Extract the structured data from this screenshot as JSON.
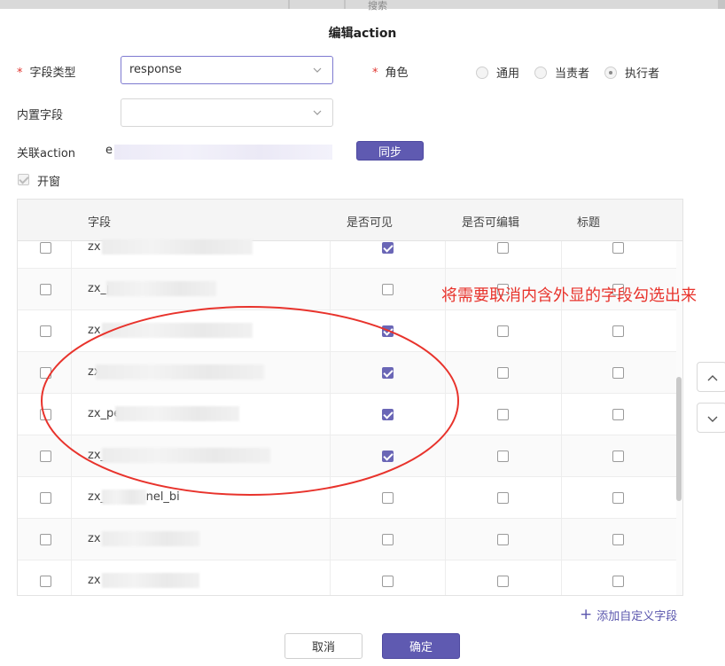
{
  "topbar": {
    "ghost_text": "搜索"
  },
  "dialog": {
    "title": "编辑action"
  },
  "form": {
    "field_type": {
      "label": "字段类型",
      "value": "response"
    },
    "role": {
      "label": "角色",
      "options": [
        "通用",
        "当责者",
        "执行者"
      ],
      "selected": "执行者"
    },
    "builtin_field": {
      "label": "内置字段",
      "value": ""
    },
    "linked_action": {
      "label": "关联action",
      "value_prefix": "e",
      "sync_label": "同步"
    },
    "open_window": {
      "label": "开窗",
      "checked": true
    }
  },
  "table": {
    "columns": [
      "字段",
      "是否可见",
      "是否可编辑",
      "标题"
    ],
    "rows": [
      {
        "field": "zx",
        "visible": true,
        "editable": false,
        "title": false
      },
      {
        "field": "zx_p",
        "visible": false,
        "editable": false,
        "title": false
      },
      {
        "field": "zx",
        "visible": true,
        "editable": false,
        "title": false
      },
      {
        "field": "zx",
        "visible": true,
        "editable": false,
        "title": false
      },
      {
        "field": "zx_per",
        "visible": true,
        "editable": false,
        "title": false
      },
      {
        "field": "zx_",
        "visible": true,
        "editable": false,
        "title": false
      },
      {
        "field": "zx_personnel_bi",
        "visible": false,
        "editable": false,
        "title": false
      },
      {
        "field": "zx",
        "visible": false,
        "editable": false,
        "title": false
      },
      {
        "field": "zx",
        "visible": false,
        "editable": false,
        "title": false
      }
    ]
  },
  "annotation": {
    "text": "将需要取消内含外显的字段勾选出来",
    "color": "#e8332c"
  },
  "add_custom_field": {
    "label": "添加自定义字段"
  },
  "footer": {
    "cancel_label": "取消",
    "confirm_label": "确定"
  },
  "colors": {
    "primary": "#5f5ab1",
    "annotation": "#e8332c"
  }
}
